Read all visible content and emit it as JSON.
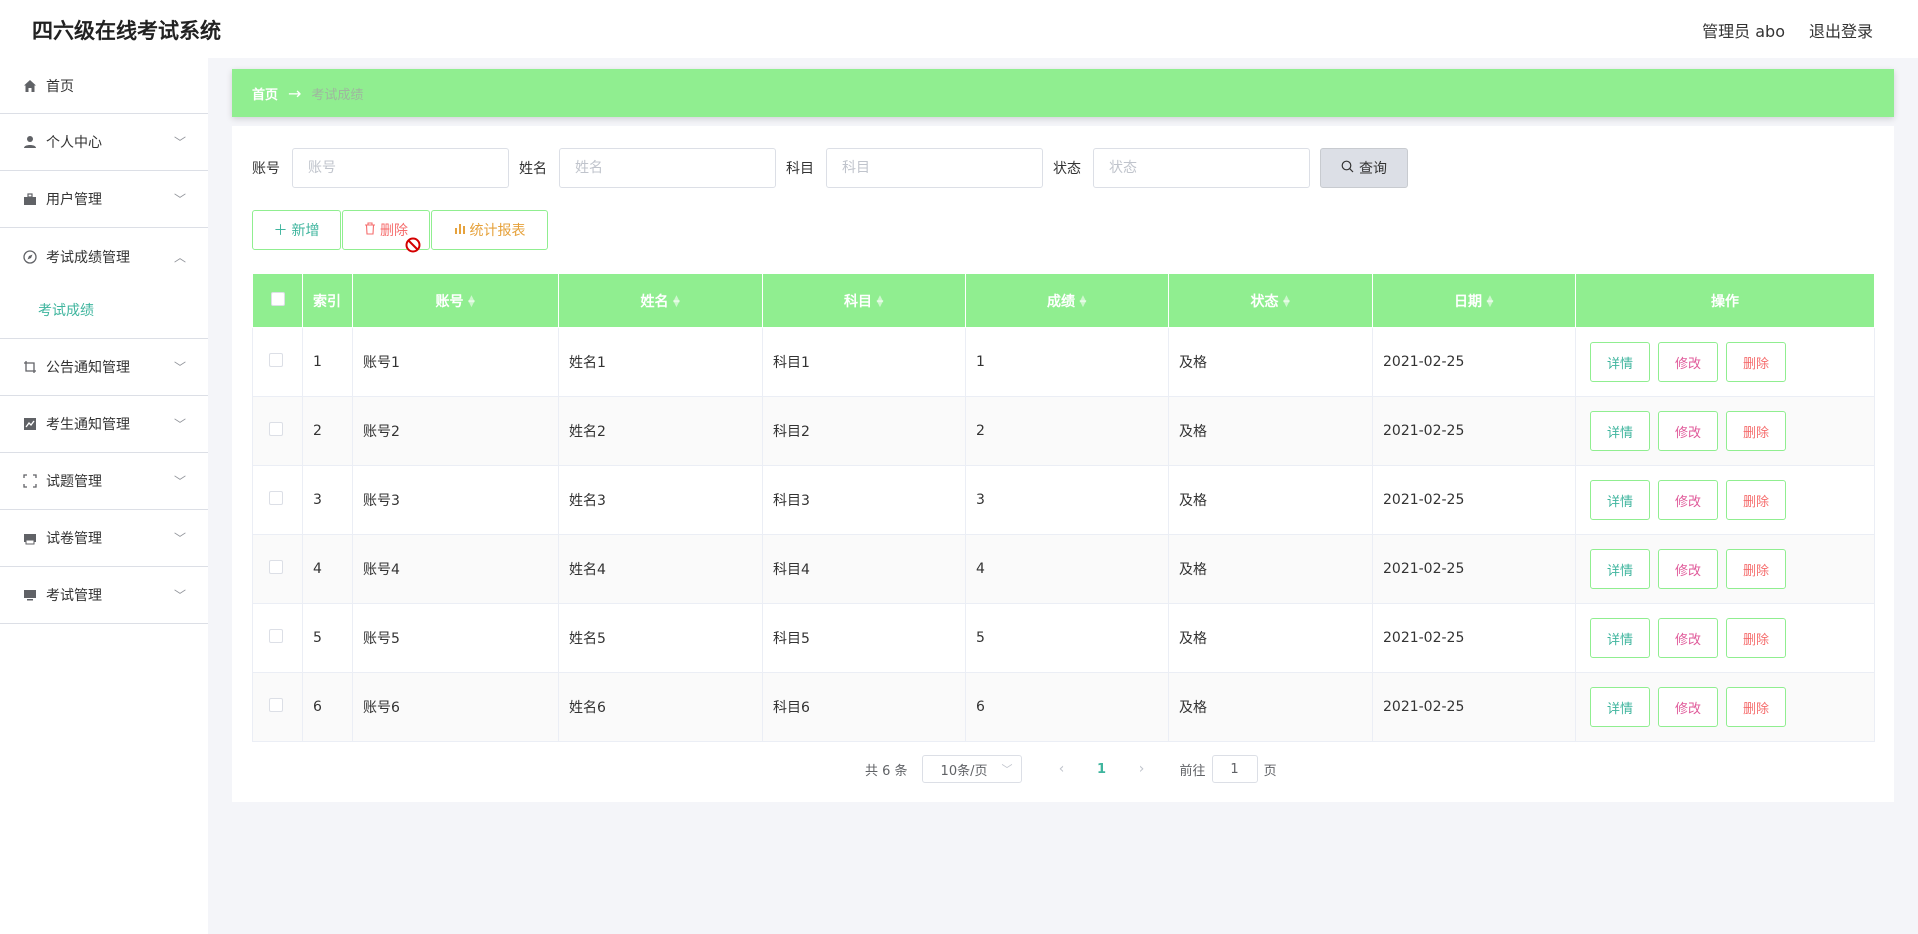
{
  "header": {
    "app_title": "四六级在线考试系统",
    "user_label": "管理员 abo",
    "logout_label": "退出登录"
  },
  "sidebar": {
    "items": [
      {
        "label": "首页",
        "icon": "home-icon"
      },
      {
        "label": "个人中心",
        "icon": "user-icon"
      },
      {
        "label": "用户管理",
        "icon": "briefcase-icon"
      },
      {
        "label": "考试成绩管理",
        "icon": "compass-icon",
        "expanded": true,
        "children": [
          "考试成绩"
        ]
      },
      {
        "label": "公告通知管理",
        "icon": "crop-icon"
      },
      {
        "label": "考生通知管理",
        "icon": "chart-line-icon"
      },
      {
        "label": "试题管理",
        "icon": "fullscreen-icon"
      },
      {
        "label": "试卷管理",
        "icon": "printer-icon"
      },
      {
        "label": "考试管理",
        "icon": "monitor-icon"
      }
    ]
  },
  "breadcrumb": {
    "home": "首页",
    "separator": "→",
    "current": "考试成绩"
  },
  "search": {
    "fields": [
      {
        "label": "账号",
        "placeholder": "账号"
      },
      {
        "label": "姓名",
        "placeholder": "姓名"
      },
      {
        "label": "科目",
        "placeholder": "科目"
      },
      {
        "label": "状态",
        "placeholder": "状态"
      }
    ],
    "query_label": "查询"
  },
  "actions": {
    "add_label": "新增",
    "delete_label": "删除",
    "stats_label": "统计报表"
  },
  "table": {
    "columns": [
      "索引",
      "账号",
      "姓名",
      "科目",
      "成绩",
      "状态",
      "日期",
      "操作"
    ],
    "rows": [
      {
        "index": "1",
        "account": "账号1",
        "name": "姓名1",
        "subject": "科目1",
        "score": "1",
        "status": "及格",
        "date": "2021-02-25"
      },
      {
        "index": "2",
        "account": "账号2",
        "name": "姓名2",
        "subject": "科目2",
        "score": "2",
        "status": "及格",
        "date": "2021-02-25"
      },
      {
        "index": "3",
        "account": "账号3",
        "name": "姓名3",
        "subject": "科目3",
        "score": "3",
        "status": "及格",
        "date": "2021-02-25"
      },
      {
        "index": "4",
        "account": "账号4",
        "name": "姓名4",
        "subject": "科目4",
        "score": "4",
        "status": "及格",
        "date": "2021-02-25"
      },
      {
        "index": "5",
        "account": "账号5",
        "name": "姓名5",
        "subject": "科目5",
        "score": "5",
        "status": "及格",
        "date": "2021-02-25"
      },
      {
        "index": "6",
        "account": "账号6",
        "name": "姓名6",
        "subject": "科目6",
        "score": "6",
        "status": "及格",
        "date": "2021-02-25"
      }
    ],
    "row_actions": {
      "detail": "详情",
      "edit": "修改",
      "delete": "删除"
    }
  },
  "pagination": {
    "total_text": "共 6 条",
    "page_size": "10条/页",
    "current_page": "1",
    "goto_label": "前往",
    "goto_value": "1",
    "page_suffix": "页"
  },
  "colors": {
    "accent_green": "#90ee90",
    "text_teal": "#3fb59e",
    "danger": "#f56c6c",
    "warning": "#e6a23c"
  }
}
